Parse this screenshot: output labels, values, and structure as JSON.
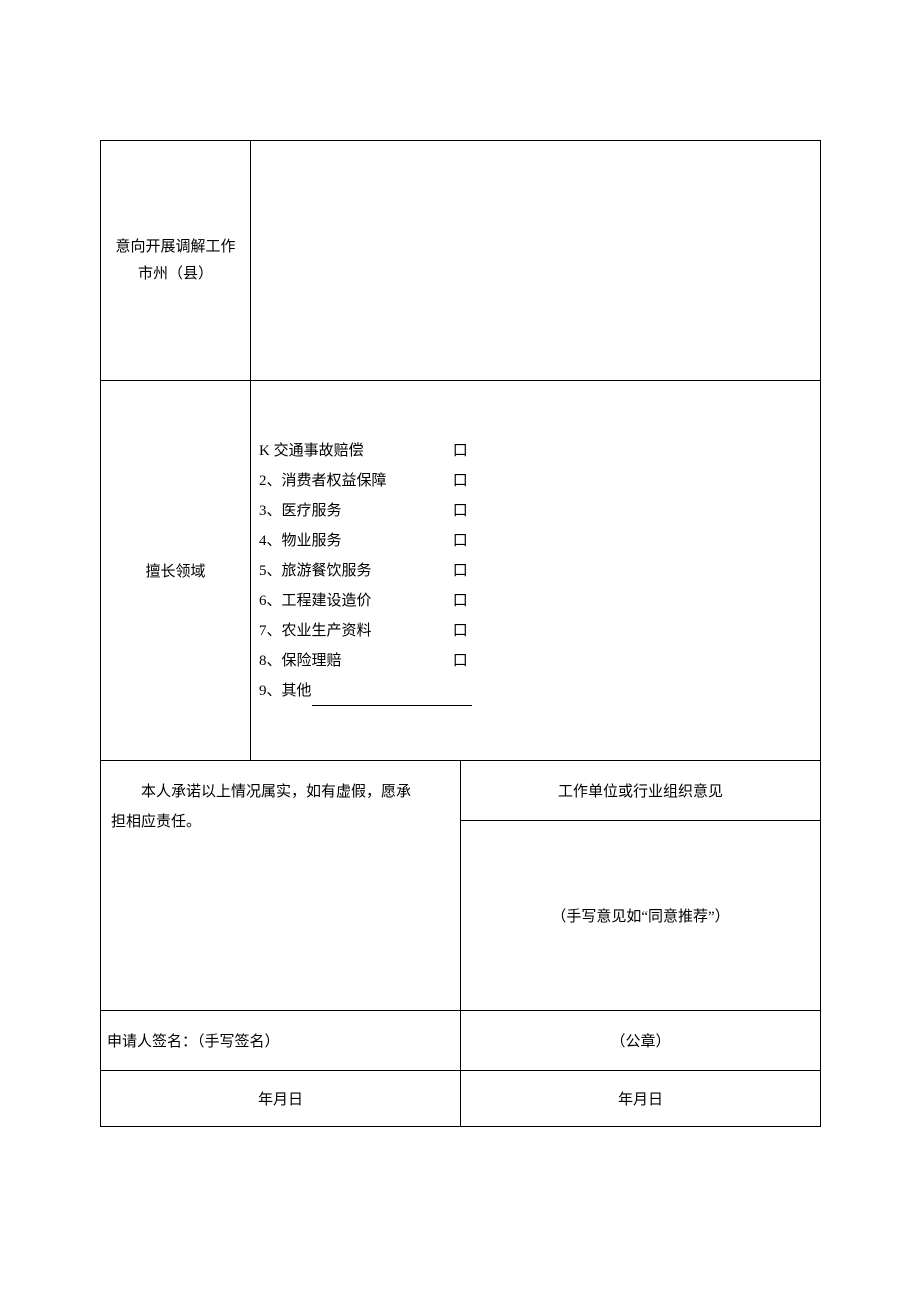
{
  "row1": {
    "label_line1": "意向开展调解工作",
    "label_line2": "市州（县）"
  },
  "row2": {
    "label": "擅长领域",
    "items": [
      {
        "num": "K",
        "text": "交通事故赔偿",
        "box": "口"
      },
      {
        "num": "2、",
        "text": "消费者权益保障",
        "box": "口"
      },
      {
        "num": "3、",
        "text": "医疗服务",
        "box": "口"
      },
      {
        "num": "4、",
        "text": "物业服务",
        "box": "口"
      },
      {
        "num": "5、",
        "text": "旅游餐饮服务",
        "box": "口"
      },
      {
        "num": "6、",
        "text": "工程建设造价",
        "box": "口"
      },
      {
        "num": "7、",
        "text": "农业生产资料",
        "box": "口"
      },
      {
        "num": "8、",
        "text": "保险理赔",
        "box": "口"
      }
    ],
    "other_label": "9、其他"
  },
  "row3": {
    "header_right": "工作单位或行业组织意见",
    "declaration_prefix": "本人承诺以上情况属实，如有虚假，愿承",
    "declaration_suffix": "担相应责任。",
    "opinion_hint": "（手写意见如“同意推荐”）"
  },
  "row4": {
    "signer_label": "申请人签名：（手写签名）",
    "seal": "（公章）"
  },
  "row5": {
    "date_left": "年月日",
    "date_right": "年月日"
  }
}
